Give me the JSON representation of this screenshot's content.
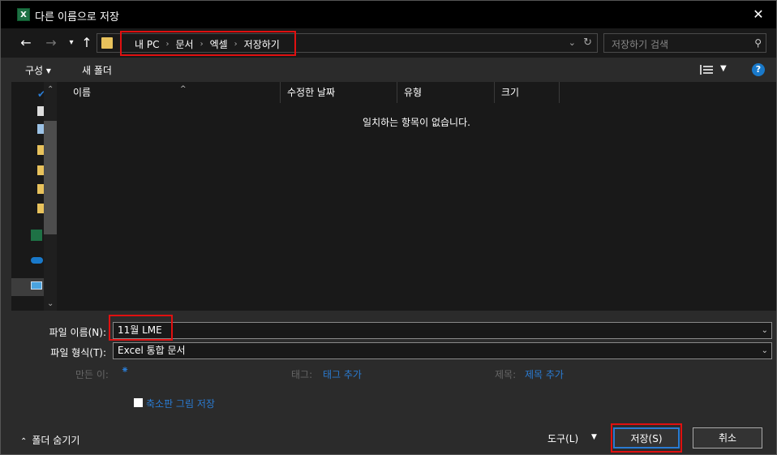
{
  "window": {
    "title": "다른 이름으로 저장",
    "app_icon_text": "X"
  },
  "nav": {
    "breadcrumbs": [
      "내 PC",
      "문서",
      "엑셀",
      "저장하기"
    ],
    "search_placeholder": "저장하기 검색"
  },
  "toolbar": {
    "organize_label": "구성 ▾",
    "new_folder_label": "새 폴더",
    "help_label": "?"
  },
  "file_list": {
    "columns": [
      "이름",
      "수정한 날짜",
      "유형",
      "크기"
    ],
    "empty_message": "일치하는 항목이 없습니다."
  },
  "form": {
    "filename_label": "파일 이름(N):",
    "filename_value": "11월 LME",
    "filetype_label": "파일 형식(T):",
    "filetype_value": "Excel 통합 문서",
    "author_label": "만든 이:",
    "tags_label": "태그:",
    "tags_link": "태그 추가",
    "title_label": "제목:",
    "title_link": "제목 추가",
    "thumbnail_label": "축소판 그림 저장"
  },
  "footer": {
    "hide_folders_label": "폴더 숨기기",
    "tools_label": "도구(L)",
    "save_label": "저장(S)",
    "cancel_label": "취소"
  },
  "colors": {
    "accent": "#2a7bd2",
    "annotation": "#e01010"
  }
}
